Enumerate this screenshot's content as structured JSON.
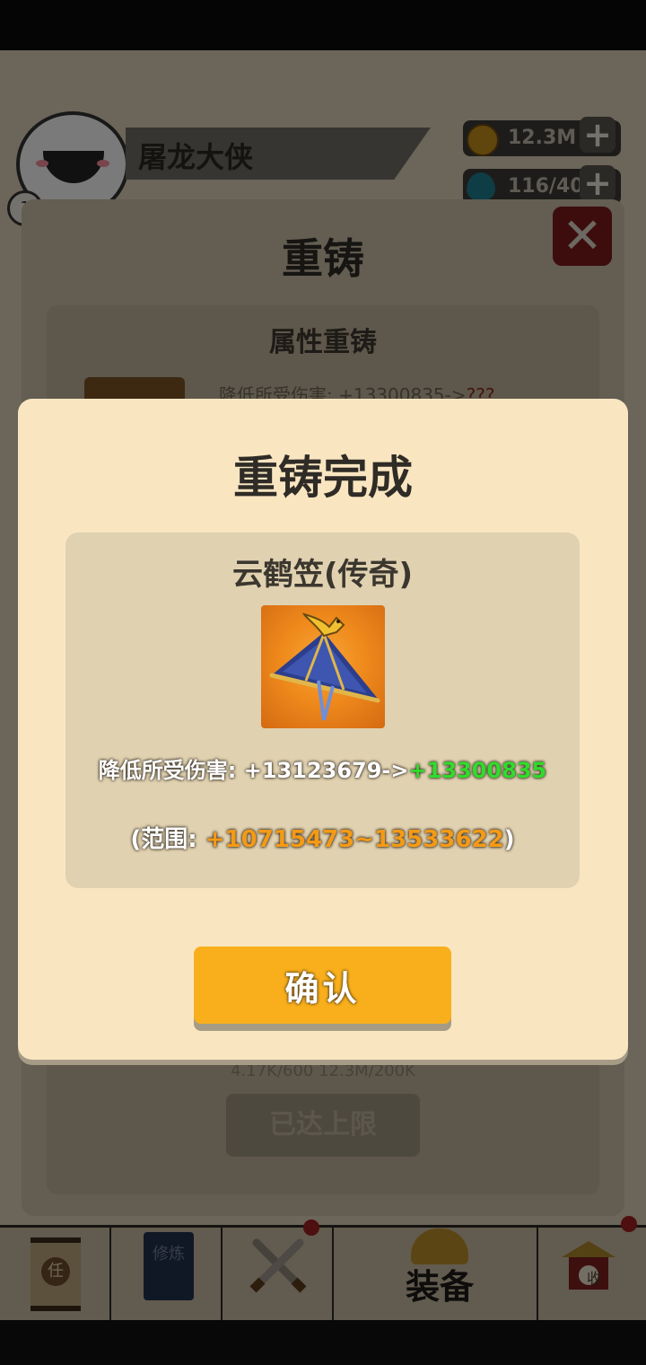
{
  "header": {
    "player_name": "屠龙大侠",
    "gold": "12.3M",
    "gems": "116/40",
    "level_partial": "1"
  },
  "reforge_panel": {
    "title": "重铸",
    "section_title": "属性重铸",
    "current_attr": "降低所受伤害: +13300835->",
    "unknown_value": "???",
    "costs": "4.17K/600 12.3M/200K",
    "maxed_label": "已达上限"
  },
  "bottom_nav": {
    "tasks_label": "任",
    "cultivation_label": "修炼",
    "equip_label": "装备",
    "collect_label": "收"
  },
  "dialog": {
    "title": "重铸完成",
    "item_name": "云鹤笠(传奇)",
    "stat_prefix": "降低所受伤害: +13123679->",
    "stat_new": "+13300835",
    "range_open": "(范围: ",
    "range_values": "+10715473~13533622",
    "range_close": ")",
    "confirm_label": "确认"
  },
  "colors": {
    "dialog_bg": "#f9e6c1",
    "item_box_bg": "#e0d1b0",
    "confirm_button": "#f9af1c",
    "new_value_green": "#2fdc2a",
    "range_orange": "#f59a16"
  },
  "icons": {
    "item_icon": "straw-hat-with-crane-icon",
    "close_icon": "close-x-icon",
    "gold_icon": "coin-icon",
    "gem_icon": "gem-icon"
  }
}
